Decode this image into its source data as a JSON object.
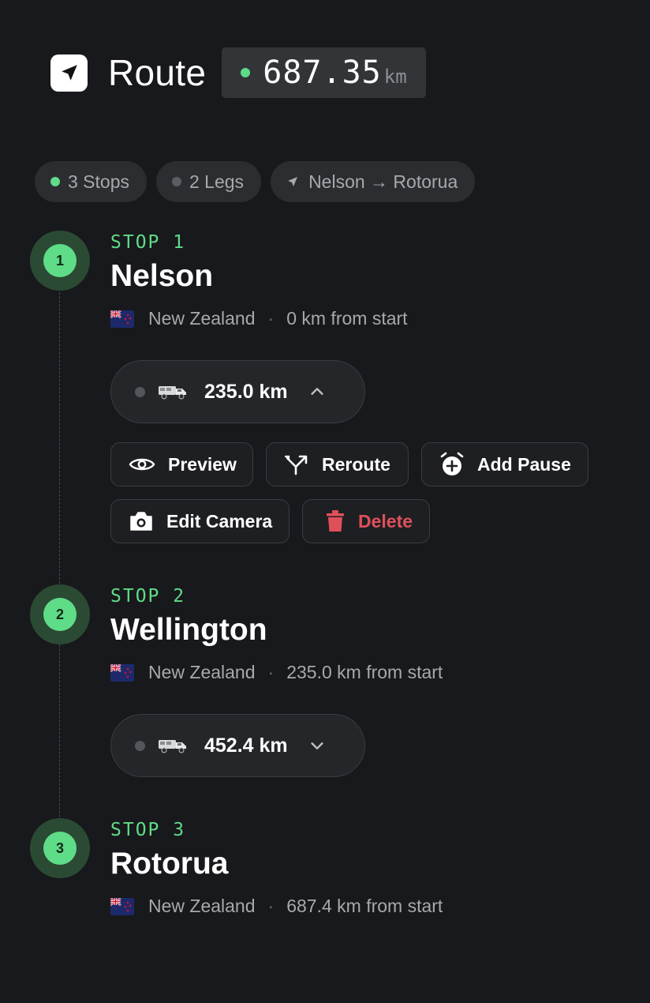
{
  "header": {
    "title": "Route",
    "total_distance": "687.35",
    "unit": "km"
  },
  "chips": {
    "stops": "3 Stops",
    "legs": "2 Legs",
    "route": "Nelson → Rotorua"
  },
  "stops": [
    {
      "number": "1",
      "label": "STOP 1",
      "name": "Nelson",
      "country": "New Zealand",
      "from_start": "0 km from start"
    },
    {
      "number": "2",
      "label": "STOP 2",
      "name": "Wellington",
      "country": "New Zealand",
      "from_start": "235.0 km from start"
    },
    {
      "number": "3",
      "label": "STOP 3",
      "name": "Rotorua",
      "country": "New Zealand",
      "from_start": "687.4 km from start"
    }
  ],
  "legs": [
    {
      "distance": "235.0 km",
      "expanded": true
    },
    {
      "distance": "452.4 km",
      "expanded": false
    }
  ],
  "actions": {
    "preview": "Preview",
    "reroute": "Reroute",
    "add_pause": "Add Pause",
    "edit_camera": "Edit Camera",
    "delete": "Delete"
  },
  "colors": {
    "accent": "#5fdc87",
    "danger": "#e0505a",
    "background": "#18191c"
  },
  "icons": {
    "logo": "navigation-arrow-icon",
    "vehicle": "truck-icon",
    "flag": "new-zealand-flag-icon"
  }
}
